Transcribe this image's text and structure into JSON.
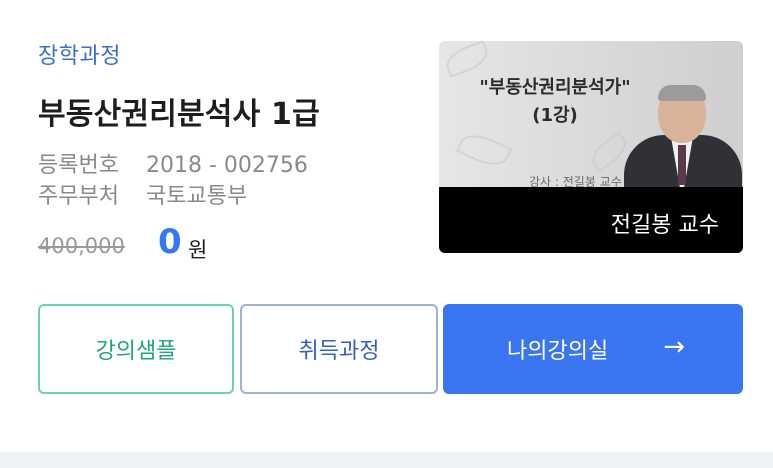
{
  "course": {
    "category": "장학과정",
    "title": "부동산권리분석사 1급",
    "registration_label": "등록번호",
    "registration_value": "2018 - 002756",
    "ministry_label": "주무부처",
    "ministry_value": "국토교통부",
    "original_price": "400,000",
    "sale_price": "0",
    "currency_unit": "원"
  },
  "thumbnail": {
    "title_line1": "\"부동산권리분석가\"",
    "title_line2": "(1강)",
    "subtitle": "강사 : 전길봉 교수",
    "caption": "전길봉 교수"
  },
  "buttons": {
    "sample": "강의샘플",
    "course": "취득과정",
    "my_room": "나의강의실",
    "my_room_icon": "arrow-right-icon"
  },
  "colors": {
    "category": "#3a6fcf",
    "sale_price": "#3478f6",
    "sample_border": "#6ccfb9",
    "primary_button": "#3a75f2"
  }
}
